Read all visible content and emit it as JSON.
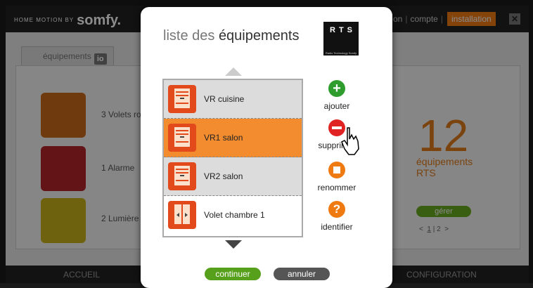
{
  "app": {
    "logo_prefix": "HOME MOTION BY",
    "logo_brand": "somfy.",
    "nav": [
      "on",
      "compte",
      "installation"
    ],
    "close_icon": "close-icon"
  },
  "tab": {
    "label": "équipements",
    "badge": "io"
  },
  "categories": [
    {
      "label": "3 Volets ro",
      "icon": "shutter-icon",
      "color": "#c96a1a"
    },
    {
      "label": "1 Alarme",
      "icon": "alarm-house-icon",
      "color": "#b3262a"
    },
    {
      "label": "2 Lumière",
      "icon": "light-bulb-icon",
      "color": "#c9b21a"
    }
  ],
  "summary": {
    "count": "12",
    "line1": "équipements",
    "line2": "RTS",
    "manage": "gérer",
    "pager_prev": "<",
    "pager_1": "1",
    "pager_2": "2",
    "pager_next": ">"
  },
  "bottom": {
    "home": "ACCUEIL",
    "config": "CONFIGURATION"
  },
  "modal": {
    "title_light": "liste des",
    "title_strong": "équipements",
    "rts_letters": "RTS",
    "rts_sub": "Radio Technology Somfy",
    "devices": [
      {
        "label": "VR cuisine",
        "selected": false
      },
      {
        "label": "VR1 salon",
        "selected": true
      },
      {
        "label": "VR2 salon",
        "selected": false
      },
      {
        "label": "Volet chambre 1",
        "selected": false
      }
    ],
    "actions": [
      {
        "label": "ajouter",
        "icon": "plus-icon",
        "color": "#2e9d2e"
      },
      {
        "label": "supprimer",
        "icon": "minus-icon",
        "color": "#e02222"
      },
      {
        "label": "renommer",
        "icon": "stop-square-icon",
        "color": "#f07a12"
      },
      {
        "label": "identifier",
        "icon": "question-icon",
        "color": "#f07a12"
      }
    ],
    "continue_label": "continuer",
    "cancel_label": "annuler"
  }
}
